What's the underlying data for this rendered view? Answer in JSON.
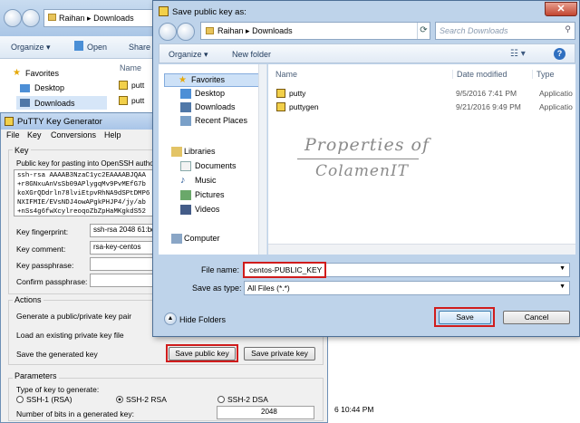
{
  "explorer": {
    "breadcrumb": [
      "Raihan",
      "Downloads"
    ],
    "toolbar": {
      "organize": "Organize ▾",
      "open": "Open",
      "share": "Share"
    },
    "nav": {
      "favorites": "Favorites",
      "desktop": "Desktop",
      "downloads": "Downloads"
    },
    "col_name": "Name",
    "files": [
      "putt",
      "putt"
    ],
    "date_fragment": "6 10:44 PM"
  },
  "putty": {
    "title": "PuTTY Key Generator",
    "menu": [
      "File",
      "Key",
      "Conversions",
      "Help"
    ],
    "key_group": "Key",
    "pubkey_label": "Public key for pasting into OpenSSH autho",
    "pubkey_lines": [
      "ssh-rsa AAAAB3NzaC1yc2EAAAABJQAA",
      "+r8GNxuAnVsSb09APlygqMv9PvMEfG7b",
      "koXGrQDdrln78lviEtpvRhNA9dSPtDMP6",
      "NXIFMIE/EVsNDJ4owAPgkPHJP4/jy/ab",
      "+nSs4g6fwXcylreoqoZbZpHaMKgkdS52"
    ],
    "fingerprint_label": "Key fingerprint:",
    "fingerprint_value": "ssh-rsa 2048 61:bd",
    "comment_label": "Key comment:",
    "comment_value": "rsa-key-centos",
    "passphrase_label": "Key passphrase:",
    "confirm_label": "Confirm passphrase:",
    "actions_group": "Actions",
    "action_generate": "Generate a public/private key pair",
    "action_load": "Load an existing private key file",
    "action_save": "Save the generated key",
    "save_public_btn": "Save public key",
    "save_private_btn": "Save private key",
    "params_group": "Parameters",
    "key_type_label": "Type of key to generate:",
    "radio_ssh1": "SSH-1 (RSA)",
    "radio_ssh2rsa": "SSH-2 RSA",
    "radio_ssh2dsa": "SSH-2 DSA",
    "bits_label": "Number of bits in a generated key:",
    "bits_value": "2048"
  },
  "dialog": {
    "title": "Save public key as:",
    "breadcrumb": [
      "Raihan",
      "Downloads"
    ],
    "search_placeholder": "Search Downloads",
    "organize": "Organize ▾",
    "new_folder": "New folder",
    "nav": {
      "favorites": "Favorites",
      "desktop": "Desktop",
      "downloads": "Downloads",
      "recent": "Recent Places",
      "libraries": "Libraries",
      "documents": "Documents",
      "music": "Music",
      "pictures": "Pictures",
      "videos": "Videos",
      "computer": "Computer"
    },
    "columns": {
      "name": "Name",
      "date": "Date modified",
      "type": "Type"
    },
    "files": [
      {
        "name": "putty",
        "date": "9/5/2016 7:41 PM",
        "type": "Applicatio"
      },
      {
        "name": "puttygen",
        "date": "9/21/2016 9:49 PM",
        "type": "Applicatio"
      }
    ],
    "watermark_line1": "Properties of",
    "watermark_line2": "ColamenIT",
    "filename_label": "File name:",
    "filename_value": "centos-PUBLIC_KEY",
    "saveas_label": "Save as type:",
    "saveas_value": "All Files (*.*)",
    "hide_folders": "Hide Folders",
    "save_btn": "Save",
    "cancel_btn": "Cancel"
  },
  "colors": {
    "highlight_red": "#d01c1c",
    "accent_blue": "#4d6f96"
  }
}
